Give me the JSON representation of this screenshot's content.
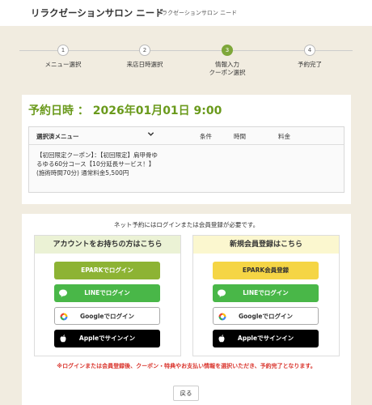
{
  "header": {
    "shop_name": "リラクゼーションサロン ニード",
    "shop_sub": "リラクゼーションサロン ニード"
  },
  "steps": [
    {
      "num": "1",
      "label": "メニュー選択",
      "state": "done"
    },
    {
      "num": "2",
      "label": "来店日時選択",
      "state": "done"
    },
    {
      "num": "3",
      "label": "情報入力\nクーポン選択",
      "state": "active"
    },
    {
      "num": "4",
      "label": "予約完了",
      "state": "pending"
    }
  ],
  "reservation": {
    "datetime": "予約日時 ： 2026年01月01日 9:00",
    "table_headers": {
      "menu": "選択済メニュー",
      "condition": "条件",
      "time": "時間",
      "price": "料金"
    },
    "menu_description": "【初回限定クーポン】：【初回限定】肩甲骨ゆるゆる60分コース【10分延長サービス！】(施術時間70分) 通常料金5,500円"
  },
  "login": {
    "notice": "ネット予約にはログインまたは会員登録が必要です。",
    "member_panel": {
      "title": "アカウントをお持ちの方はこちら",
      "epark": "EPARKでログイン",
      "line": "LINEでログイン",
      "google": "Googleでログイン",
      "apple": "Appleでサインイン"
    },
    "new_panel": {
      "title": "新規会員登録はこちら",
      "epark": "EPARK会員登録",
      "line": "LINEでログイン",
      "google": "Googleでログイン",
      "apple": "Appleでサインイン"
    },
    "warning": "※ログインまたは会員登録後、クーポン・特典やお支払い情報を選択いただき、予約完了となります。",
    "back": "戻る"
  },
  "colors": {
    "accent_green": "#6a9a1c",
    "epark_green": "#8db334",
    "epark_yellow": "#f5d545",
    "line_green": "#49b748",
    "warning_red": "#d9332b"
  },
  "icons": [
    "chevron-down-icon",
    "line-icon",
    "google-icon",
    "apple-icon"
  ]
}
